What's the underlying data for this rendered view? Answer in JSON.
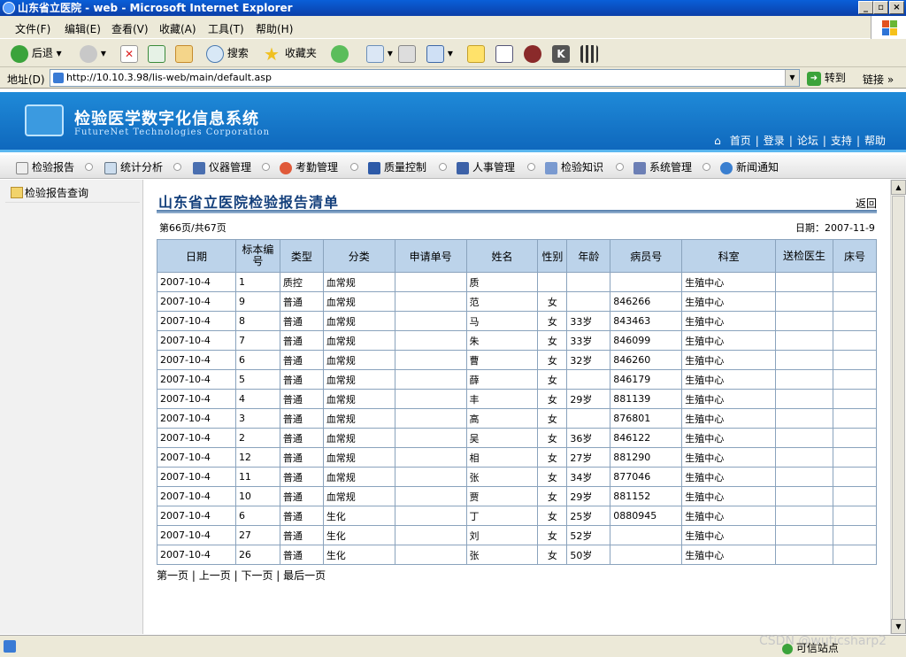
{
  "window": {
    "title": "山东省立医院 - web - Microsoft Internet Explorer",
    "min": "_",
    "max": "▫",
    "close": "×"
  },
  "menu": [
    "文件(F)",
    "编辑(E)",
    "查看(V)",
    "收藏(A)",
    "工具(T)",
    "帮助(H)"
  ],
  "toolbar": {
    "back": "后退",
    "search": "搜索",
    "favorites": "收藏夹"
  },
  "address": {
    "label": "地址(D)",
    "url": "http://10.10.3.98/lis-web/main/default.asp",
    "go": "转到",
    "links": "链接"
  },
  "banner": {
    "title": "检验医学数字化信息系统",
    "subtitle": "FutureNet Technologies Corporation",
    "nav": [
      "首页",
      "登录",
      "论坛",
      "支持",
      "帮助"
    ]
  },
  "modules": [
    "检验报告",
    "统计分析",
    "仪器管理",
    "考勤管理",
    "质量控制",
    "人事管理",
    "检验知识",
    "系统管理",
    "新闻通知"
  ],
  "sidebar": {
    "item": "检验报告查询"
  },
  "page": {
    "title": "山东省立医院检验报告清单",
    "back": "返回",
    "pageinfo": "第66页/共67页",
    "date": "日期：2007-11-9"
  },
  "table": {
    "headers": [
      "日期",
      "标本编号",
      "类型",
      "分类",
      "申请单号",
      "姓名",
      "性别",
      "年龄",
      "病员号",
      "科室",
      "送检医生",
      "床号"
    ],
    "rows": [
      [
        "2007-10-4",
        "1",
        "质控",
        "血常规",
        "",
        "质",
        "",
        "",
        "",
        "生殖中心",
        "",
        ""
      ],
      [
        "2007-10-4",
        "9",
        "普通",
        "血常规",
        "",
        "范",
        "女",
        "",
        "846266",
        "生殖中心",
        "",
        ""
      ],
      [
        "2007-10-4",
        "8",
        "普通",
        "血常规",
        "",
        "马",
        "女",
        "33岁",
        "843463",
        "生殖中心",
        "",
        ""
      ],
      [
        "2007-10-4",
        "7",
        "普通",
        "血常规",
        "",
        "朱",
        "女",
        "33岁",
        "846099",
        "生殖中心",
        "",
        ""
      ],
      [
        "2007-10-4",
        "6",
        "普通",
        "血常规",
        "",
        "曹",
        "女",
        "32岁",
        "846260",
        "生殖中心",
        "",
        ""
      ],
      [
        "2007-10-4",
        "5",
        "普通",
        "血常规",
        "",
        "薛",
        "女",
        "",
        "846179",
        "生殖中心",
        "",
        ""
      ],
      [
        "2007-10-4",
        "4",
        "普通",
        "血常规",
        "",
        "丰",
        "女",
        "29岁",
        "881139",
        "生殖中心",
        "",
        ""
      ],
      [
        "2007-10-4",
        "3",
        "普通",
        "血常规",
        "",
        "高",
        "女",
        "",
        "876801",
        "生殖中心",
        "",
        ""
      ],
      [
        "2007-10-4",
        "2",
        "普通",
        "血常规",
        "",
        "吴",
        "女",
        "36岁",
        "846122",
        "生殖中心",
        "",
        ""
      ],
      [
        "2007-10-4",
        "12",
        "普通",
        "血常规",
        "",
        "相",
        "女",
        "27岁",
        "881290",
        "生殖中心",
        "",
        ""
      ],
      [
        "2007-10-4",
        "11",
        "普通",
        "血常规",
        "",
        "张",
        "女",
        "34岁",
        "877046",
        "生殖中心",
        "",
        ""
      ],
      [
        "2007-10-4",
        "10",
        "普通",
        "血常规",
        "",
        "贾",
        "女",
        "29岁",
        "881152",
        "生殖中心",
        "",
        ""
      ],
      [
        "2007-10-4",
        "6",
        "普通",
        "生化",
        "",
        "丁",
        "女",
        "25岁",
        "0880945",
        "生殖中心",
        "",
        ""
      ],
      [
        "2007-10-4",
        "27",
        "普通",
        "生化",
        "",
        "刘",
        "女",
        "52岁",
        "",
        "生殖中心",
        "",
        ""
      ],
      [
        "2007-10-4",
        "26",
        "普通",
        "生化",
        "",
        "张",
        "女",
        "50岁",
        "",
        "生殖中心",
        "",
        ""
      ]
    ]
  },
  "pager": {
    "first": "第一页",
    "prev": "上一页",
    "next": "下一页",
    "last": "最后一页",
    "sep": "|"
  },
  "status": {
    "zone": "可信站点",
    "watermark": "CSDN @wuticsharp2"
  },
  "icons": {
    "back": "back-arrow-icon",
    "forward": "forward-arrow-icon",
    "stop": "stop-icon",
    "refresh": "refresh-icon",
    "home": "home-icon",
    "search": "search-icon",
    "favorites": "star-icon",
    "history": "history-icon",
    "mail": "mail-icon",
    "print": "print-icon",
    "edit": "edit-icon"
  }
}
